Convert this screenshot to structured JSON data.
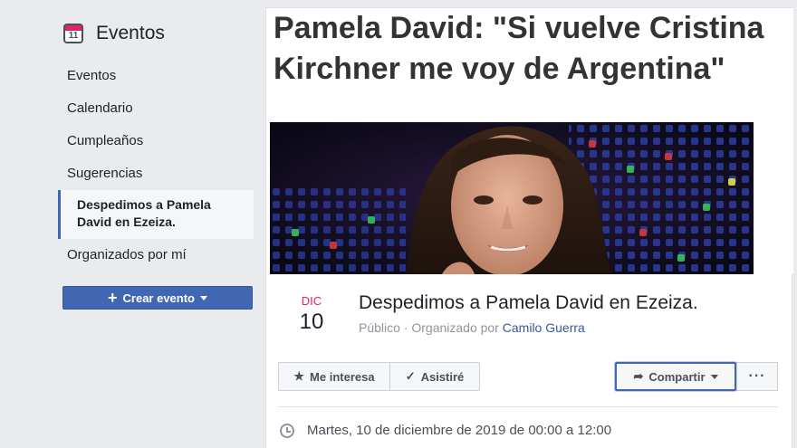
{
  "sidebar": {
    "title": "Eventos",
    "calendar_icon_day": "11",
    "items": [
      {
        "label": "Eventos"
      },
      {
        "label": "Calendario"
      },
      {
        "label": "Cumpleaños"
      },
      {
        "label": "Sugerencias"
      },
      {
        "label": "Despedimos a Pamela David en Ezeiza."
      },
      {
        "label": "Organizados por mí"
      }
    ],
    "create_button": "Crear evento"
  },
  "cover": {
    "headline": "Pamela David: \"Si vuelve Cristina Kirchner me voy de Argentina\""
  },
  "event": {
    "month": "DIC",
    "day": "10",
    "title": "Despedimos a Pamela David en Ezeiza.",
    "privacy": "Público",
    "organized_by_label": "Organizado por",
    "organizer": "Camilo Guerra",
    "datetime": "Martes, 10 de diciembre de 2019 de 00:00 a 12:00"
  },
  "actions": {
    "interested": "Me interesa",
    "going": "Asistiré",
    "share": "Compartir",
    "more": "···"
  },
  "colors": {
    "brand": "#4267b2",
    "date_accent": "#e0245e",
    "link": "#365899"
  }
}
